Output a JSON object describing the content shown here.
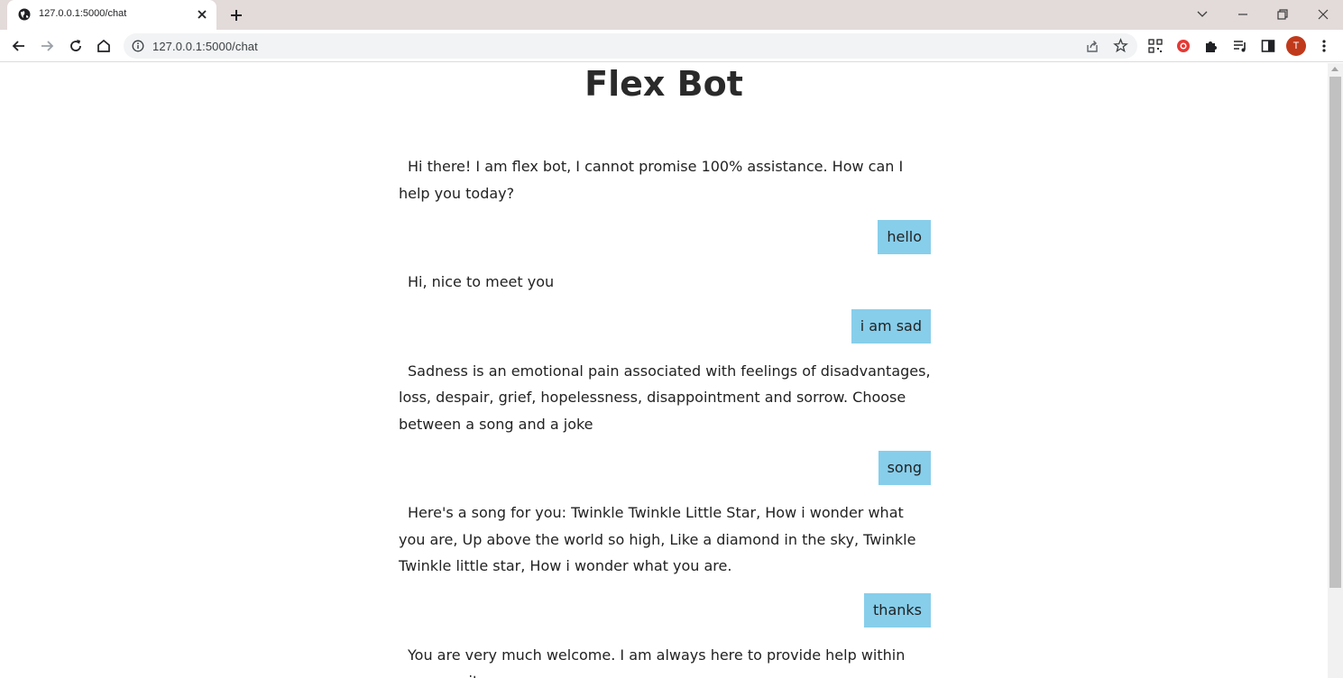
{
  "browser": {
    "tab_title": "127.0.0.1:5000/chat",
    "url": "127.0.0.1:5000/chat",
    "avatar_letter": "T"
  },
  "page": {
    "title": "Flex Bot"
  },
  "chat": {
    "messages": [
      {
        "sender": "bot",
        "text": "Hi there! I am flex bot, I cannot promise 100% assistance. How can I help you today?"
      },
      {
        "sender": "user",
        "text": "hello"
      },
      {
        "sender": "bot",
        "text": "Hi, nice to meet you"
      },
      {
        "sender": "user",
        "text": "i am sad"
      },
      {
        "sender": "bot",
        "text": "Sadness is an emotional pain associated with feelings of disadvantages, loss, despair, grief, hopelessness, disappointment and sorrow. Choose between a song and a joke"
      },
      {
        "sender": "user",
        "text": "song"
      },
      {
        "sender": "bot",
        "text": "Here's a song for you: Twinkle Twinkle Little Star, How i wonder what you are, Up above the world so high, Like a diamond in the sky, Twinkle Twinkle little star, How i wonder what you are."
      },
      {
        "sender": "user",
        "text": "thanks"
      },
      {
        "sender": "bot",
        "text": "You are very much welcome. I am always here to provide help within my capacity"
      }
    ]
  },
  "colors": {
    "user_bubble": "#87ceeb",
    "tabstrip": "#e3dada",
    "avatar": "#c0391b"
  }
}
